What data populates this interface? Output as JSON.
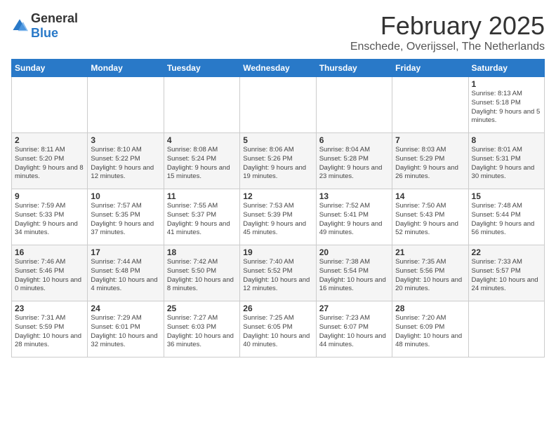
{
  "header": {
    "logo_general": "General",
    "logo_blue": "Blue",
    "title": "February 2025",
    "location": "Enschede, Overijssel, The Netherlands"
  },
  "weekdays": [
    "Sunday",
    "Monday",
    "Tuesday",
    "Wednesday",
    "Thursday",
    "Friday",
    "Saturday"
  ],
  "weeks": [
    [
      {
        "day": "",
        "info": ""
      },
      {
        "day": "",
        "info": ""
      },
      {
        "day": "",
        "info": ""
      },
      {
        "day": "",
        "info": ""
      },
      {
        "day": "",
        "info": ""
      },
      {
        "day": "",
        "info": ""
      },
      {
        "day": "1",
        "info": "Sunrise: 8:13 AM\nSunset: 5:18 PM\nDaylight: 9 hours and 5 minutes."
      }
    ],
    [
      {
        "day": "2",
        "info": "Sunrise: 8:11 AM\nSunset: 5:20 PM\nDaylight: 9 hours and 8 minutes."
      },
      {
        "day": "3",
        "info": "Sunrise: 8:10 AM\nSunset: 5:22 PM\nDaylight: 9 hours and 12 minutes."
      },
      {
        "day": "4",
        "info": "Sunrise: 8:08 AM\nSunset: 5:24 PM\nDaylight: 9 hours and 15 minutes."
      },
      {
        "day": "5",
        "info": "Sunrise: 8:06 AM\nSunset: 5:26 PM\nDaylight: 9 hours and 19 minutes."
      },
      {
        "day": "6",
        "info": "Sunrise: 8:04 AM\nSunset: 5:28 PM\nDaylight: 9 hours and 23 minutes."
      },
      {
        "day": "7",
        "info": "Sunrise: 8:03 AM\nSunset: 5:29 PM\nDaylight: 9 hours and 26 minutes."
      },
      {
        "day": "8",
        "info": "Sunrise: 8:01 AM\nSunset: 5:31 PM\nDaylight: 9 hours and 30 minutes."
      }
    ],
    [
      {
        "day": "9",
        "info": "Sunrise: 7:59 AM\nSunset: 5:33 PM\nDaylight: 9 hours and 34 minutes."
      },
      {
        "day": "10",
        "info": "Sunrise: 7:57 AM\nSunset: 5:35 PM\nDaylight: 9 hours and 37 minutes."
      },
      {
        "day": "11",
        "info": "Sunrise: 7:55 AM\nSunset: 5:37 PM\nDaylight: 9 hours and 41 minutes."
      },
      {
        "day": "12",
        "info": "Sunrise: 7:53 AM\nSunset: 5:39 PM\nDaylight: 9 hours and 45 minutes."
      },
      {
        "day": "13",
        "info": "Sunrise: 7:52 AM\nSunset: 5:41 PM\nDaylight: 9 hours and 49 minutes."
      },
      {
        "day": "14",
        "info": "Sunrise: 7:50 AM\nSunset: 5:43 PM\nDaylight: 9 hours and 52 minutes."
      },
      {
        "day": "15",
        "info": "Sunrise: 7:48 AM\nSunset: 5:44 PM\nDaylight: 9 hours and 56 minutes."
      }
    ],
    [
      {
        "day": "16",
        "info": "Sunrise: 7:46 AM\nSunset: 5:46 PM\nDaylight: 10 hours and 0 minutes."
      },
      {
        "day": "17",
        "info": "Sunrise: 7:44 AM\nSunset: 5:48 PM\nDaylight: 10 hours and 4 minutes."
      },
      {
        "day": "18",
        "info": "Sunrise: 7:42 AM\nSunset: 5:50 PM\nDaylight: 10 hours and 8 minutes."
      },
      {
        "day": "19",
        "info": "Sunrise: 7:40 AM\nSunset: 5:52 PM\nDaylight: 10 hours and 12 minutes."
      },
      {
        "day": "20",
        "info": "Sunrise: 7:38 AM\nSunset: 5:54 PM\nDaylight: 10 hours and 16 minutes."
      },
      {
        "day": "21",
        "info": "Sunrise: 7:35 AM\nSunset: 5:56 PM\nDaylight: 10 hours and 20 minutes."
      },
      {
        "day": "22",
        "info": "Sunrise: 7:33 AM\nSunset: 5:57 PM\nDaylight: 10 hours and 24 minutes."
      }
    ],
    [
      {
        "day": "23",
        "info": "Sunrise: 7:31 AM\nSunset: 5:59 PM\nDaylight: 10 hours and 28 minutes."
      },
      {
        "day": "24",
        "info": "Sunrise: 7:29 AM\nSunset: 6:01 PM\nDaylight: 10 hours and 32 minutes."
      },
      {
        "day": "25",
        "info": "Sunrise: 7:27 AM\nSunset: 6:03 PM\nDaylight: 10 hours and 36 minutes."
      },
      {
        "day": "26",
        "info": "Sunrise: 7:25 AM\nSunset: 6:05 PM\nDaylight: 10 hours and 40 minutes."
      },
      {
        "day": "27",
        "info": "Sunrise: 7:23 AM\nSunset: 6:07 PM\nDaylight: 10 hours and 44 minutes."
      },
      {
        "day": "28",
        "info": "Sunrise: 7:20 AM\nSunset: 6:09 PM\nDaylight: 10 hours and 48 minutes."
      },
      {
        "day": "",
        "info": ""
      }
    ]
  ]
}
